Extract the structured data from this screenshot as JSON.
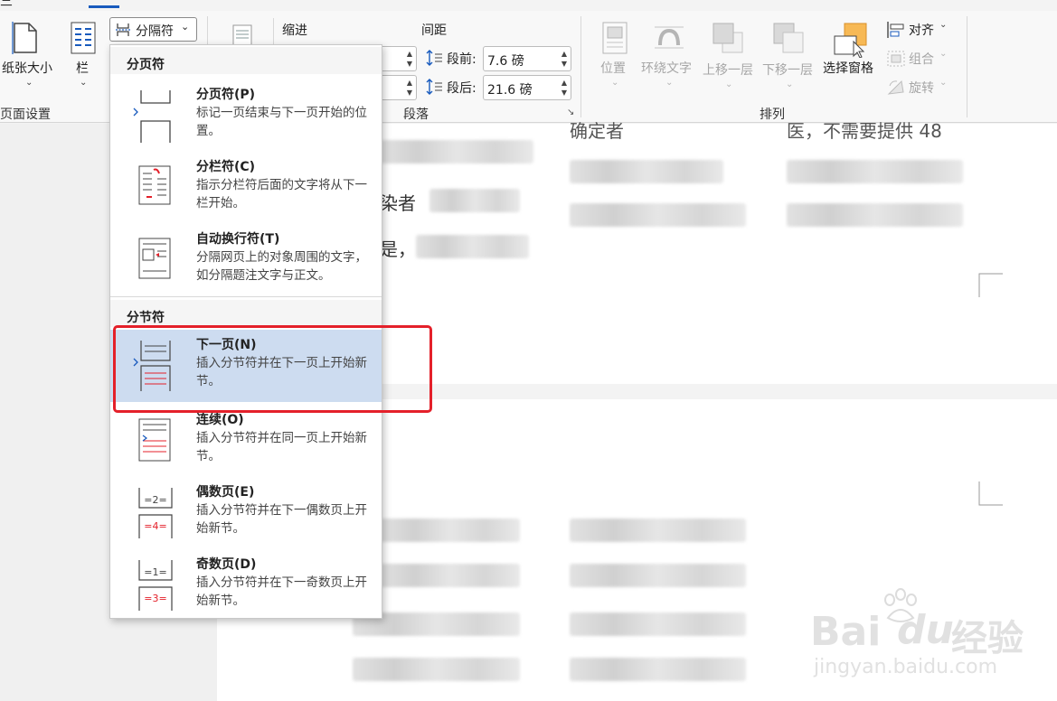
{
  "ribbon": {
    "page_setup": {
      "size_label": "纸张大小",
      "columns_label": "栏",
      "breaks_label": "分隔符",
      "group_label": "页面设置"
    },
    "paragraph": {
      "indent_label": "缩进",
      "spacing_label": "间距",
      "before_label": "段前:",
      "before_value": "7.6 磅",
      "after_label": "段后:",
      "after_value": "21.6 磅",
      "group_label": "段落"
    },
    "arrange": {
      "position_label": "位置",
      "wrap_label": "环绕文字",
      "forward_label": "上移一层",
      "backward_label": "下移一层",
      "selection_pane_label": "选择窗格",
      "align_label": "对齐",
      "group_obj_label": "组合",
      "rotate_label": "旋转",
      "group_label": "排列"
    }
  },
  "menu": {
    "page_breaks_header": "分页符",
    "section_breaks_header": "分节符",
    "items": [
      {
        "title": "分页符(P)",
        "desc": "标记一页结束与下一页开始的位置。"
      },
      {
        "title": "分栏符(C)",
        "desc": "指示分栏符后面的文字将从下一栏开始。"
      },
      {
        "title": "自动换行符(T)",
        "desc": "分隔网页上的对象周围的文字，如分隔题注文字与正文。"
      },
      {
        "title": "下一页(N)",
        "desc": "插入分节符并在下一页上开始新节。"
      },
      {
        "title": "连续(O)",
        "desc": "插入分节符并在同一页上开始新节。"
      },
      {
        "title": "偶数页(E)",
        "desc": "插入分节符并在下一偶数页上开始新节。"
      },
      {
        "title": "奇数页(D)",
        "desc": "插入分节符并在下一奇数页上开始新节。"
      }
    ]
  },
  "document": {
    "line1": "确定者",
    "line1b": "医，不需要提供 48",
    "line2": "染者",
    "line3": "是，"
  },
  "watermark": {
    "brand": "Bai",
    "brand2": "经验",
    "url": "jingyan.baidu.com"
  },
  "colors": {
    "highlight": "#cddcf0",
    "callout_border": "#e4202a",
    "accent": "#185abd"
  }
}
